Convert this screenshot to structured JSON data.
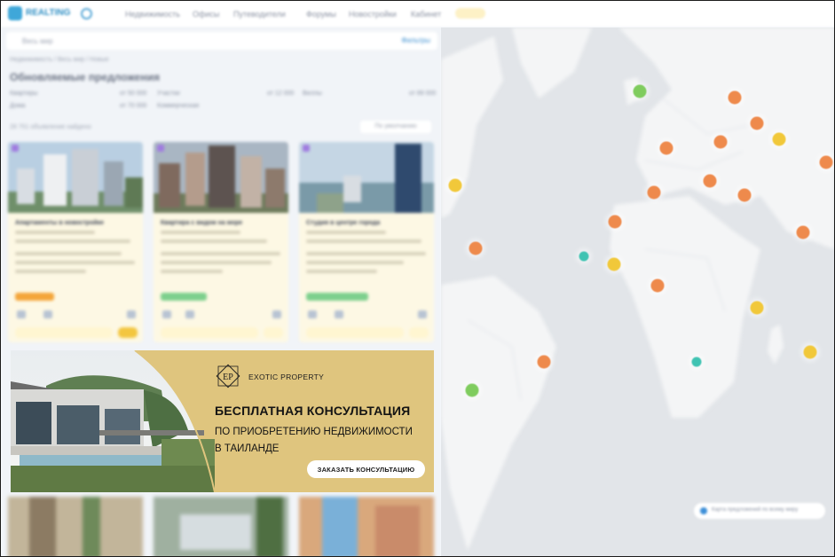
{
  "nav": {
    "logo": "REALTING",
    "items": [
      "Недвижимость",
      "Офисы",
      "Путеводители",
      "Форумы",
      "Новостройки",
      "Кабинет"
    ]
  },
  "search": {
    "placeholder": "Весь мир",
    "button": "Фильтры"
  },
  "breadcrumb": "Недвижимость / Весь мир / Новые",
  "page_title": "Обновляемые предложения",
  "filters": [
    [
      "Квартиры",
      "от 50 000",
      "Участки",
      "от 12 000",
      "Виллы",
      "от 89 000"
    ],
    [
      "Дома",
      "от 70 000",
      "Коммерческая",
      "",
      "",
      ""
    ]
  ],
  "results_count": "28 751 объявление найдено",
  "sort_label": "По умолчанию",
  "cards": [
    {
      "title": "Апартаменты в новостройке"
    },
    {
      "title": "Квартира с видом на море"
    },
    {
      "title": "Студия в центре города"
    }
  ],
  "banner": {
    "brand": "EXOTIC PROPERTY",
    "logo_letters": "EP",
    "headline": "БЕСПЛАТНАЯ КОНСУЛЬТАЦИЯ",
    "sub_line1": "ПО ПРИОБРЕТЕНИЮ НЕДВИЖИМОСТИ",
    "sub_line2": "В ТАИЛАНДЕ",
    "cta": "ЗАКАЗАТЬ КОНСУЛЬТАЦИЮ",
    "bg_color": "#dfc57e"
  },
  "map": {
    "note": "Карта предложений по всему миру",
    "marker_colors": {
      "orange": "#ee8a4c",
      "yellow": "#f1c83a",
      "green": "#7fcc5e",
      "teal": "#3fc3b2"
    }
  }
}
